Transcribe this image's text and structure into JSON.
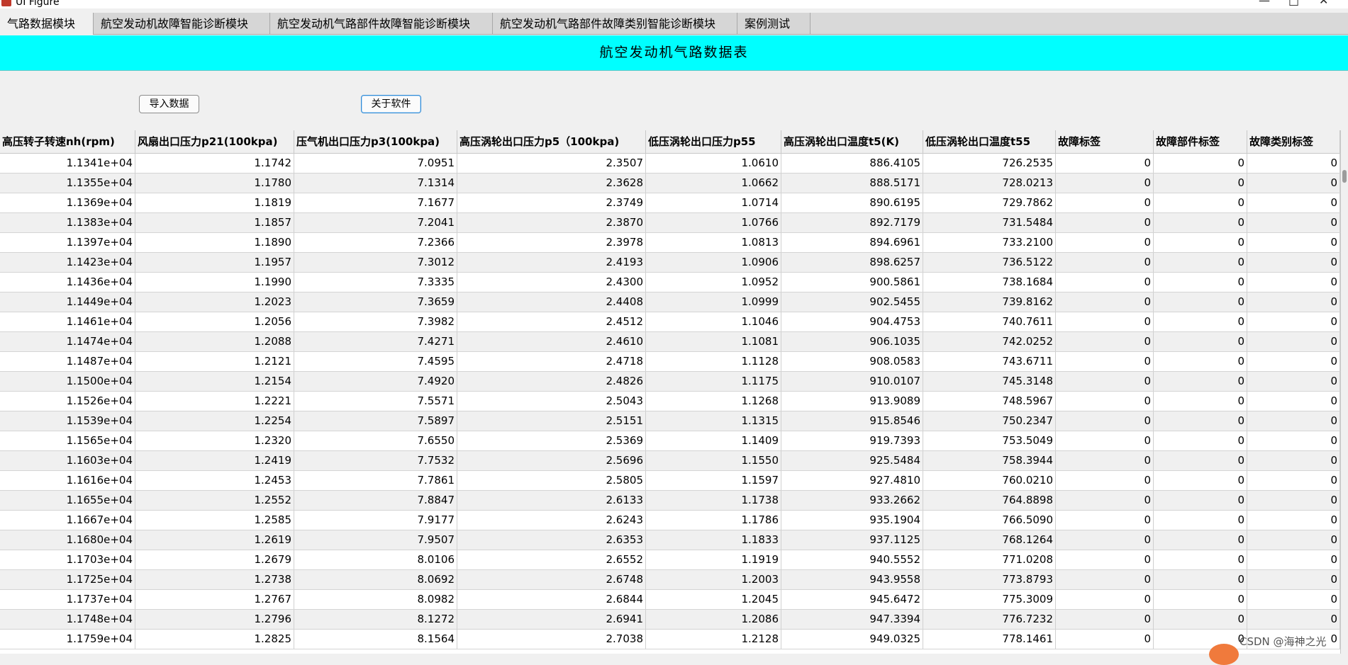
{
  "window": {
    "title": "UI Figure"
  },
  "tabs": [
    {
      "label": "气路数据模块",
      "active": true
    },
    {
      "label": "航空发动机故障智能诊断模块",
      "active": false
    },
    {
      "label": "航空发动机气路部件故障智能诊断模块",
      "active": false
    },
    {
      "label": "航空发动机气路部件故障类别智能诊断模块",
      "active": false
    },
    {
      "label": "案例测试",
      "active": false
    }
  ],
  "banner": {
    "title": "航空发动机气路数据表",
    "color": "#00ffff"
  },
  "buttons": {
    "import_label": "导入数据",
    "about_label": "关于软件"
  },
  "table": {
    "columns": [
      "高压转子转速nh(rpm)",
      "风扇出口压力p21(100kpa)",
      "压气机出口压力p3(100kpa)",
      "高压涡轮出口压力p5（100kpa)",
      "低压涡轮出口压力p55",
      "高压涡轮出口温度t5(K)",
      "低压涡轮出口温度t55",
      "故障标签",
      "故障部件标签",
      "故障类别标签"
    ],
    "rows": [
      [
        "1.1341e+04",
        "1.1742",
        "7.0951",
        "2.3507",
        "1.0610",
        "886.4105",
        "726.2535",
        "0",
        "0",
        "0"
      ],
      [
        "1.1355e+04",
        "1.1780",
        "7.1314",
        "2.3628",
        "1.0662",
        "888.5171",
        "728.0213",
        "0",
        "0",
        "0"
      ],
      [
        "1.1369e+04",
        "1.1819",
        "7.1677",
        "2.3749",
        "1.0714",
        "890.6195",
        "729.7862",
        "0",
        "0",
        "0"
      ],
      [
        "1.1383e+04",
        "1.1857",
        "7.2041",
        "2.3870",
        "1.0766",
        "892.7179",
        "731.5484",
        "0",
        "0",
        "0"
      ],
      [
        "1.1397e+04",
        "1.1890",
        "7.2366",
        "2.3978",
        "1.0813",
        "894.6961",
        "733.2100",
        "0",
        "0",
        "0"
      ],
      [
        "1.1423e+04",
        "1.1957",
        "7.3012",
        "2.4193",
        "1.0906",
        "898.6257",
        "736.5122",
        "0",
        "0",
        "0"
      ],
      [
        "1.1436e+04",
        "1.1990",
        "7.3335",
        "2.4300",
        "1.0952",
        "900.5861",
        "738.1684",
        "0",
        "0",
        "0"
      ],
      [
        "1.1449e+04",
        "1.2023",
        "7.3659",
        "2.4408",
        "1.0999",
        "902.5455",
        "739.8162",
        "0",
        "0",
        "0"
      ],
      [
        "1.1461e+04",
        "1.2056",
        "7.3982",
        "2.4512",
        "1.1046",
        "904.4753",
        "740.7611",
        "0",
        "0",
        "0"
      ],
      [
        "1.1474e+04",
        "1.2088",
        "7.4271",
        "2.4610",
        "1.1081",
        "906.1035",
        "742.0252",
        "0",
        "0",
        "0"
      ],
      [
        "1.1487e+04",
        "1.2121",
        "7.4595",
        "2.4718",
        "1.1128",
        "908.0583",
        "743.6711",
        "0",
        "0",
        "0"
      ],
      [
        "1.1500e+04",
        "1.2154",
        "7.4920",
        "2.4826",
        "1.1175",
        "910.0107",
        "745.3148",
        "0",
        "0",
        "0"
      ],
      [
        "1.1526e+04",
        "1.2221",
        "7.5571",
        "2.5043",
        "1.1268",
        "913.9089",
        "748.5967",
        "0",
        "0",
        "0"
      ],
      [
        "1.1539e+04",
        "1.2254",
        "7.5897",
        "2.5151",
        "1.1315",
        "915.8546",
        "750.2347",
        "0",
        "0",
        "0"
      ],
      [
        "1.1565e+04",
        "1.2320",
        "7.6550",
        "2.5369",
        "1.1409",
        "919.7393",
        "753.5049",
        "0",
        "0",
        "0"
      ],
      [
        "1.1603e+04",
        "1.2419",
        "7.7532",
        "2.5696",
        "1.1550",
        "925.5484",
        "758.3944",
        "0",
        "0",
        "0"
      ],
      [
        "1.1616e+04",
        "1.2453",
        "7.7861",
        "2.5805",
        "1.1597",
        "927.4810",
        "760.0210",
        "0",
        "0",
        "0"
      ],
      [
        "1.1655e+04",
        "1.2552",
        "7.8847",
        "2.6133",
        "1.1738",
        "933.2662",
        "764.8898",
        "0",
        "0",
        "0"
      ],
      [
        "1.1667e+04",
        "1.2585",
        "7.9177",
        "2.6243",
        "1.1786",
        "935.1904",
        "766.5090",
        "0",
        "0",
        "0"
      ],
      [
        "1.1680e+04",
        "1.2619",
        "7.9507",
        "2.6353",
        "1.1833",
        "937.1125",
        "768.1264",
        "0",
        "0",
        "0"
      ],
      [
        "1.1703e+04",
        "1.2679",
        "8.0106",
        "2.6552",
        "1.1919",
        "940.5552",
        "771.0208",
        "0",
        "0",
        "0"
      ],
      [
        "1.1725e+04",
        "1.2738",
        "8.0692",
        "2.6748",
        "1.2003",
        "943.9558",
        "773.8793",
        "0",
        "0",
        "0"
      ],
      [
        "1.1737e+04",
        "1.2767",
        "8.0982",
        "2.6844",
        "1.2045",
        "945.6472",
        "775.3009",
        "0",
        "0",
        "0"
      ],
      [
        "1.1748e+04",
        "1.2796",
        "8.1272",
        "2.6941",
        "1.2086",
        "947.3394",
        "776.7232",
        "0",
        "0",
        "0"
      ],
      [
        "1.1759e+04",
        "1.2825",
        "8.1564",
        "2.7038",
        "1.2128",
        "949.0325",
        "778.1461",
        "0",
        "0",
        "0"
      ]
    ]
  },
  "watermark": "CSDN @海神之光"
}
